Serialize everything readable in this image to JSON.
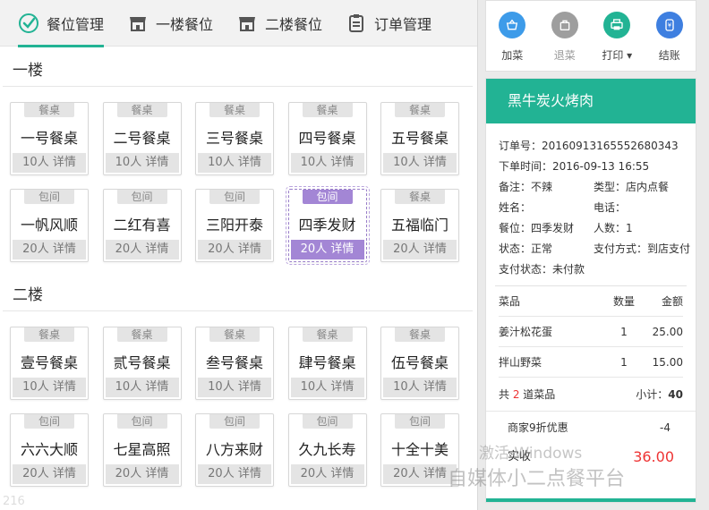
{
  "tabs": [
    {
      "label": "餐位管理",
      "icon": "table-setting-icon",
      "active": true
    },
    {
      "label": "一楼餐位",
      "icon": "storefront-icon",
      "active": false
    },
    {
      "label": "二楼餐位",
      "icon": "storefront-icon",
      "active": false
    },
    {
      "label": "订单管理",
      "icon": "clipboard-icon",
      "active": false
    }
  ],
  "floors": [
    {
      "title": "一楼",
      "tables": [
        {
          "type": "餐桌",
          "name": "一号餐桌",
          "footer": "10人 详情"
        },
        {
          "type": "餐桌",
          "name": "二号餐桌",
          "footer": "10人 详情"
        },
        {
          "type": "餐桌",
          "name": "三号餐桌",
          "footer": "10人 详情"
        },
        {
          "type": "餐桌",
          "name": "四号餐桌",
          "footer": "10人 详情"
        },
        {
          "type": "餐桌",
          "name": "五号餐桌",
          "footer": "10人 详情"
        },
        {
          "type": "包间",
          "name": "一帆风顺",
          "footer": "20人 详情"
        },
        {
          "type": "包间",
          "name": "二红有喜",
          "footer": "20人 详情"
        },
        {
          "type": "包间",
          "name": "三阳开泰",
          "footer": "20人 详情"
        },
        {
          "type": "包间",
          "name": "四季发财",
          "footer": "20人 详情",
          "selected": true
        },
        {
          "type": "餐桌",
          "name": "五福临门",
          "footer": "20人 详情"
        }
      ]
    },
    {
      "title": "二楼",
      "tables": [
        {
          "type": "餐桌",
          "name": "壹号餐桌",
          "footer": "10人 详情"
        },
        {
          "type": "餐桌",
          "name": "贰号餐桌",
          "footer": "10人 详情"
        },
        {
          "type": "餐桌",
          "name": "叁号餐桌",
          "footer": "10人 详情"
        },
        {
          "type": "餐桌",
          "name": "肆号餐桌",
          "footer": "10人 详情"
        },
        {
          "type": "餐桌",
          "name": "伍号餐桌",
          "footer": "10人 详情"
        },
        {
          "type": "包间",
          "name": "六六大顺",
          "footer": "20人 详情"
        },
        {
          "type": "包间",
          "name": "七星高照",
          "footer": "20人 详情"
        },
        {
          "type": "包间",
          "name": "八方来财",
          "footer": "20人 详情"
        },
        {
          "type": "包间",
          "name": "久九长寿",
          "footer": "20人 详情"
        },
        {
          "type": "包间",
          "name": "十全十美",
          "footer": "20人 详情"
        }
      ]
    }
  ],
  "actions": [
    {
      "label": "加菜",
      "icon": "basket-icon",
      "color": "#3d9be9",
      "disabled": false
    },
    {
      "label": "退菜",
      "icon": "bag-icon",
      "color": "#9e9e9e",
      "disabled": true
    },
    {
      "label": "打印 ▾",
      "icon": "printer-icon",
      "color": "#22b394",
      "disabled": false
    },
    {
      "label": "结账",
      "icon": "cash-icon",
      "color": "#3e7fe0",
      "disabled": false
    }
  ],
  "order": {
    "restaurant": "黑牛炭火烤肉",
    "order_no": "订单号：20160913165552680343",
    "time": "下单时间：2016-09-13 16:55",
    "rows": [
      [
        "备注：不辣",
        "类型：店内点餐"
      ],
      [
        "姓名：",
        "电话："
      ],
      [
        "餐位：四季发财",
        "人数：1"
      ],
      [
        "状态：正常",
        "支付方式：到店支付"
      ]
    ],
    "pay_status": "支付状态：未付款",
    "items_header": {
      "name": "菜品",
      "qty": "数量",
      "amt": "金额"
    },
    "items": [
      {
        "name": "姜汁松花蛋",
        "qty": "1",
        "amt": "25.00"
      },
      {
        "name": "拌山野菜",
        "qty": "1",
        "amt": "15.00"
      }
    ],
    "count_prefix": "共 ",
    "count": "2",
    "count_suffix": " 道菜品",
    "subtotal_label": "小计：",
    "subtotal": "40",
    "discount_label": "商家9折优惠",
    "discount": "-4",
    "paid_label": "实收",
    "paid": "36.00"
  },
  "watermarks": {
    "windows": "激活 Windows",
    "brand": "自媒体小二点餐平台",
    "left": "216"
  }
}
